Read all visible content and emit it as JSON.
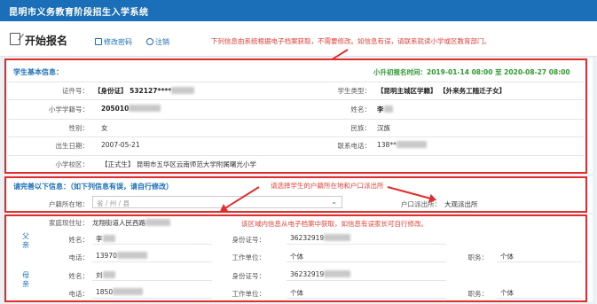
{
  "app": {
    "title": "昆明市义务教育阶段招生入学系统"
  },
  "header": {
    "page_title": "开始报名",
    "change_password": "修改密码",
    "logout": "注销"
  },
  "notes": {
    "note1": "下列信息由系统根据电子档案获取，不需要修改。如信息有误，请联系就读小学或区教育部门。",
    "note2": "请选择学生的户籍所在地和户口派出所",
    "note3": "该区域内信息从电子档案中获取，如信息有误家长可自行修改。"
  },
  "student": {
    "section_title": "学生基本信息：",
    "enroll_time_label": "小升初报名时间：",
    "enroll_time_value": "2019-01-14 08:00 至 2020-08-27 08:00",
    "id_label": "证件号：",
    "id_value": "【身份证】 532127****",
    "type_label": "学生类型：",
    "type_value": "【昆明主城区学籍】 【外来务工随迁子女】",
    "xueji_label": "小学学籍号：",
    "xueji_value": "205010",
    "name_label": "姓名：",
    "name_value": "李",
    "gender_label": "性别：",
    "gender_value": "女",
    "nation_label": "民族：",
    "nation_value": "汉族",
    "birth_label": "出生日期：",
    "birth_value": "2007-05-21",
    "phone_label": "联系电话：",
    "phone_value": "138**",
    "school_label": "小学校区：",
    "school_value": "【正式生】 昆明市五华区云南师范大学附属曙光小学"
  },
  "fill": {
    "section_title": "请完善以下信息：（如下列信息有误，请自行修改）",
    "hukou_label": "户籍所在地：",
    "hukou_placeholder": "省 / 州 / 县",
    "police_label": "户口派出所：",
    "police_value": "大观派出所"
  },
  "family": {
    "address_label": "家庭现住址：",
    "address_value": "龙翔街道人民西路",
    "father_side": "父亲",
    "mother_side": "母亲",
    "name_label": "姓名：",
    "phone_label": "电话：",
    "idcard_label": "身份证号：",
    "work_label": "工作单位：",
    "job_label": "职务：",
    "father": {
      "name": "李",
      "phone": "13970",
      "idcard": "36232919",
      "work": "个体",
      "job": "个体"
    },
    "mother": {
      "name": "刘",
      "phone": "1850",
      "idcard": "36232919",
      "work": "个体",
      "job": "个体"
    }
  }
}
